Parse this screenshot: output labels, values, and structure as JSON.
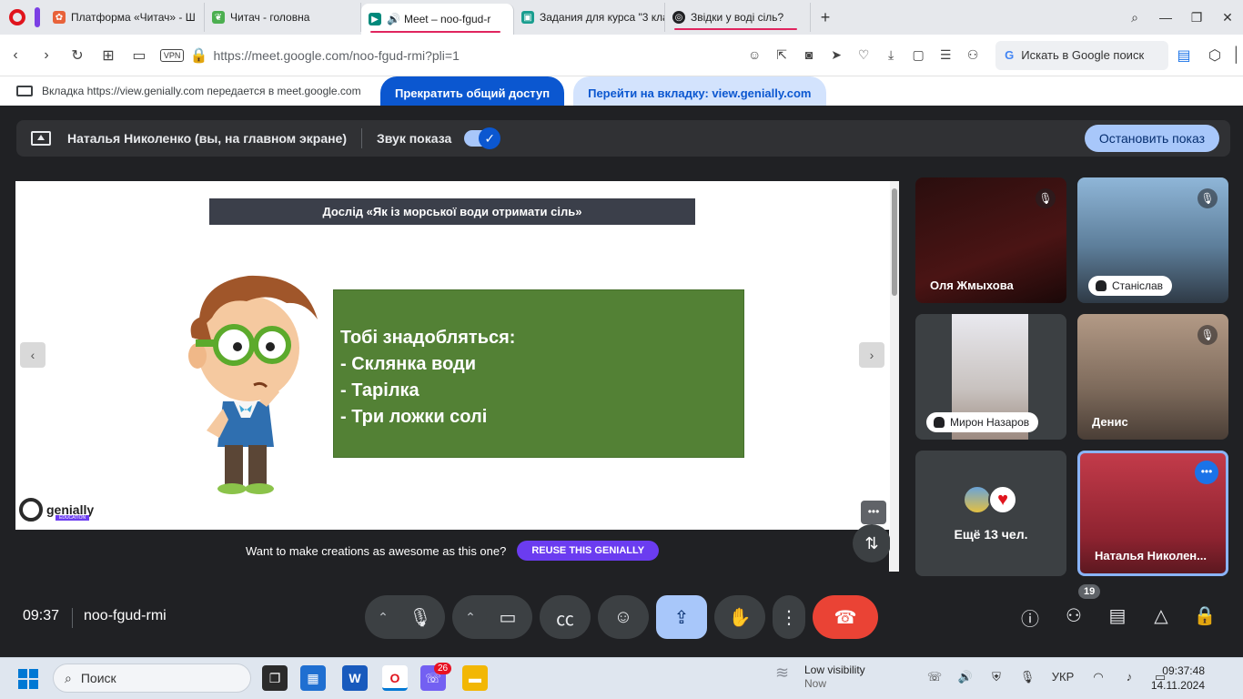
{
  "browser": {
    "tabs": [
      {
        "label": "Платформа «Читач» - Ш",
        "fav_color": "#e8623a",
        "fav_glyph": "✿"
      },
      {
        "label": "Читач - головна",
        "fav_color": "#4caf50",
        "fav_glyph": "❦"
      },
      {
        "label": "Meet – noo-fgud-r",
        "fav_color": "#00897b",
        "fav_glyph": "▶",
        "active": true
      },
      {
        "label": "Задания для курса \"3 кла",
        "fav_color": "#1a9e8f",
        "fav_glyph": "▣"
      },
      {
        "label": "Звідки у воді сіль?",
        "fav_color": "#202124",
        "fav_glyph": "◎"
      }
    ],
    "new_tab_glyph": "+",
    "url": "https://meet.google.com/noo-fgud-rmi?pli=1",
    "vpn_label": "VPN",
    "search_placeholder": "Искать в Google поиск",
    "search_g": "G"
  },
  "share_bar": {
    "message": "Вкладка https://view.genially.com передается в meet.google.com",
    "stop_sharing_label": "Прекратить общий доступ",
    "goto_tab_label": "Перейти на вкладку: view.genially.com"
  },
  "meet": {
    "presenter_label": "Наталья Николенко (вы, на главном экране)",
    "audio_label": "Звук показа",
    "audio_toggle_on": true,
    "stop_presenting_label": "Остановить показ",
    "slide": {
      "title": "Дослід «Як із морської води отримати сіль»",
      "box_heading": "Тобі знадобляться:",
      "items": [
        "-  Склянка води",
        "-  Тарілка",
        "-  Три ложки солі"
      ],
      "box_color": "#538135",
      "brand": "genially",
      "brand_badge": "EDUCATION",
      "reuse_text": "Want to make creations as awesome as this one?",
      "reuse_button": "REUSE THIS GENIALLY"
    },
    "participants": [
      {
        "name": "Оля Жмыхова",
        "muted": true,
        "style": "name"
      },
      {
        "name": "Станіслав",
        "muted": true,
        "style": "pill"
      },
      {
        "name": "Мирон Назаров",
        "muted": false,
        "style": "pill"
      },
      {
        "name": "Денис",
        "muted": true,
        "style": "name"
      }
    ],
    "more_people_label": "Ещё 13 чел.",
    "self_name": "Наталья Николен...",
    "time": "09:37",
    "meeting_code": "noo-fgud-rmi",
    "people_count": "19"
  },
  "taskbar": {
    "search_label": "Поиск",
    "viber_badge": "26",
    "weather_title": "Low visibility",
    "weather_sub": "Now",
    "language": "УКР",
    "time": "09:37:48",
    "date": "14.11.2024"
  }
}
